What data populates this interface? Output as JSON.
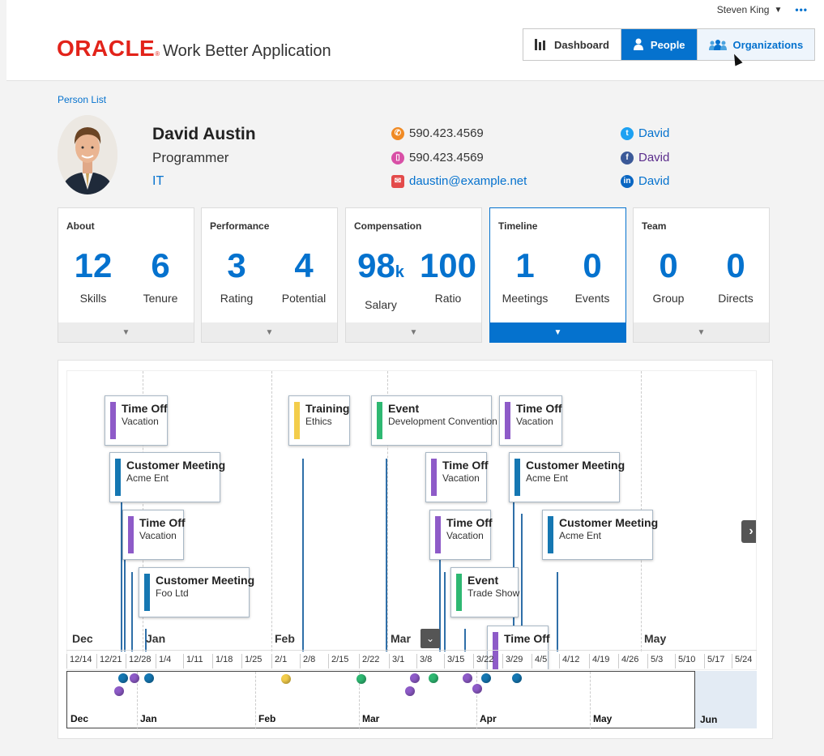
{
  "header": {
    "user_name": "Steven King",
    "more": "•••",
    "logo_text": "ORACLE",
    "logo_reg": "®",
    "app_name": "Work Better Application",
    "nav": [
      {
        "label": "Dashboard",
        "icon": "bar-chart-icon"
      },
      {
        "label": "People",
        "icon": "person-icon"
      },
      {
        "label": "Organizations",
        "icon": "group-icon"
      }
    ],
    "active_nav": "People",
    "accent_color": "#0572ce",
    "brand_color": "#e2231a"
  },
  "breadcrumb": "Person List",
  "person": {
    "name": "David Austin",
    "title": "Programmer",
    "department": "IT",
    "phone_work": "590.423.4569",
    "phone_mobile": "590.423.4569",
    "email": "daustin@example.net",
    "twitter": "David",
    "facebook": "David",
    "linkedin": "David"
  },
  "cards": [
    {
      "title": "About",
      "m1": {
        "value": "12",
        "label": "Skills"
      },
      "m2": {
        "value": "6",
        "label": "Tenure"
      }
    },
    {
      "title": "Performance",
      "m1": {
        "value": "3",
        "label": "Rating"
      },
      "m2": {
        "value": "4",
        "label": "Potential"
      }
    },
    {
      "title": "Compensation",
      "m1": {
        "value": "98",
        "suffix": "k",
        "label": "Salary"
      },
      "m2": {
        "value": "100",
        "label": "Ratio"
      }
    },
    {
      "title": "Timeline",
      "m1": {
        "value": "1",
        "label": "Meetings"
      },
      "m2": {
        "value": "0",
        "label": "Events"
      }
    },
    {
      "title": "Team",
      "m1": {
        "value": "0",
        "label": "Group"
      },
      "m2": {
        "value": "0",
        "label": "Directs"
      }
    }
  ],
  "selected_card": "Timeline",
  "timeline": {
    "events": [
      {
        "title": "Time Off",
        "sub": "Vacation",
        "color": "#8e5bc8"
      },
      {
        "title": "Customer Meeting",
        "sub": "Acme Ent",
        "color": "#1577b2"
      },
      {
        "title": "Time Off",
        "sub": "Vacation",
        "color": "#8e5bc8"
      },
      {
        "title": "Customer Meeting",
        "sub": "Foo Ltd",
        "color": "#1577b2"
      },
      {
        "title": "Training",
        "sub": "Ethics",
        "color": "#f3cd4b"
      },
      {
        "title": "Event",
        "sub": "Development Convention",
        "color": "#2eb872"
      },
      {
        "title": "Time Off",
        "sub": "Vacation",
        "color": "#8e5bc8"
      },
      {
        "title": "Time Off",
        "sub": "Vacation",
        "color": "#8e5bc8"
      },
      {
        "title": "Event",
        "sub": "Trade Show",
        "color": "#2eb872"
      },
      {
        "title": "Time Off",
        "sub": "Vacation",
        "color": "#8e5bc8"
      },
      {
        "title": "Customer Meeting",
        "sub": "Acme Ent",
        "color": "#1577b2"
      },
      {
        "title": "Customer Meeting",
        "sub": "Acme Ent",
        "color": "#1577b2"
      },
      {
        "title": "Time Off",
        "sub": "",
        "color": "#8e5bc8"
      }
    ],
    "months": [
      "Dec",
      "Jan",
      "Feb",
      "Mar",
      "May"
    ],
    "ticks": [
      "12/14",
      "12/21",
      "12/28",
      "1/4",
      "1/11",
      "1/18",
      "1/25",
      "2/1",
      "2/8",
      "2/15",
      "2/22",
      "3/1",
      "3/8",
      "3/15",
      "3/22",
      "3/29",
      "4/5",
      "4/12",
      "4/19",
      "4/26",
      "5/3",
      "5/10",
      "5/17",
      "5/24"
    ],
    "overview_months": [
      "Dec",
      "Jan",
      "Feb",
      "Mar",
      "Apr",
      "May",
      "Jun"
    ],
    "next_glyph": "›",
    "collapse_glyph": "⌄"
  }
}
